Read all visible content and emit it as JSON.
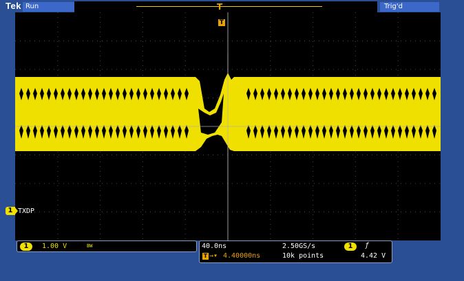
{
  "header": {
    "brand": "Tek",
    "run_state": "Run",
    "trigger_status": "Trig'd",
    "record_marker": "T"
  },
  "screen": {
    "trigger_marker": "T",
    "channel_label": "TXDP",
    "channel_number": "1"
  },
  "channel_readout": {
    "number": "1",
    "scale": "1.00 V",
    "bandwidth": "BW"
  },
  "timebase": {
    "horizontal_scale": "40.0ns",
    "sample_rate": "2.50GS/s",
    "delay": "4.40000ns",
    "record_length": "10k points",
    "trigger_source": "1",
    "trigger_slope": "ƒ",
    "trigger_level": "4.42 V"
  },
  "colors": {
    "trace": "#f0e000",
    "background": "#000000",
    "frame": "#2a4f95"
  }
}
